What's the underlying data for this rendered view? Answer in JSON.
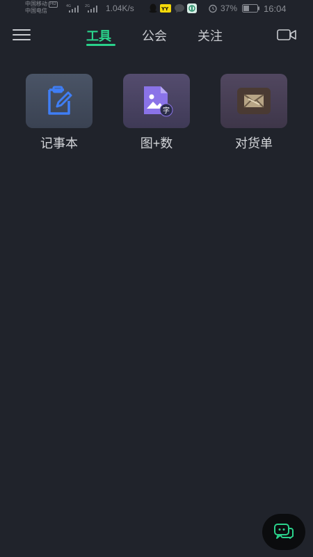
{
  "status_bar": {
    "carrier_1": "中国移动",
    "carrier_1_badge": "HD",
    "carrier_2": "中国电信",
    "net_speed": "1.04K/s",
    "battery": "37%",
    "time": "16:04",
    "icons": [
      "signal-4g-icon",
      "signal-2g-icon",
      "qq-icon",
      "yy-icon",
      "message-icon",
      "app-icon",
      "alarm-icon",
      "battery-icon"
    ]
  },
  "header": {
    "menu_icon": "menu-icon",
    "tabs": [
      {
        "label": "工具",
        "active": true
      },
      {
        "label": "公会",
        "active": false
      },
      {
        "label": "关注",
        "active": false
      }
    ],
    "video_icon": "video-camera-icon",
    "accent_color": "#2ad28b"
  },
  "tools": [
    {
      "label": "记事本",
      "icon": "notepad-icon",
      "icon_color": "#3f7ef5"
    },
    {
      "label": "图+数",
      "icon": "image-text-icon",
      "badge": "字",
      "icon_color": "#8a73e8"
    },
    {
      "label": "对货单",
      "icon": "order-sheet-icon",
      "icon_color": "#b8a586"
    }
  ],
  "fab": {
    "icon": "chat-icon",
    "color": "#2ad28b"
  }
}
